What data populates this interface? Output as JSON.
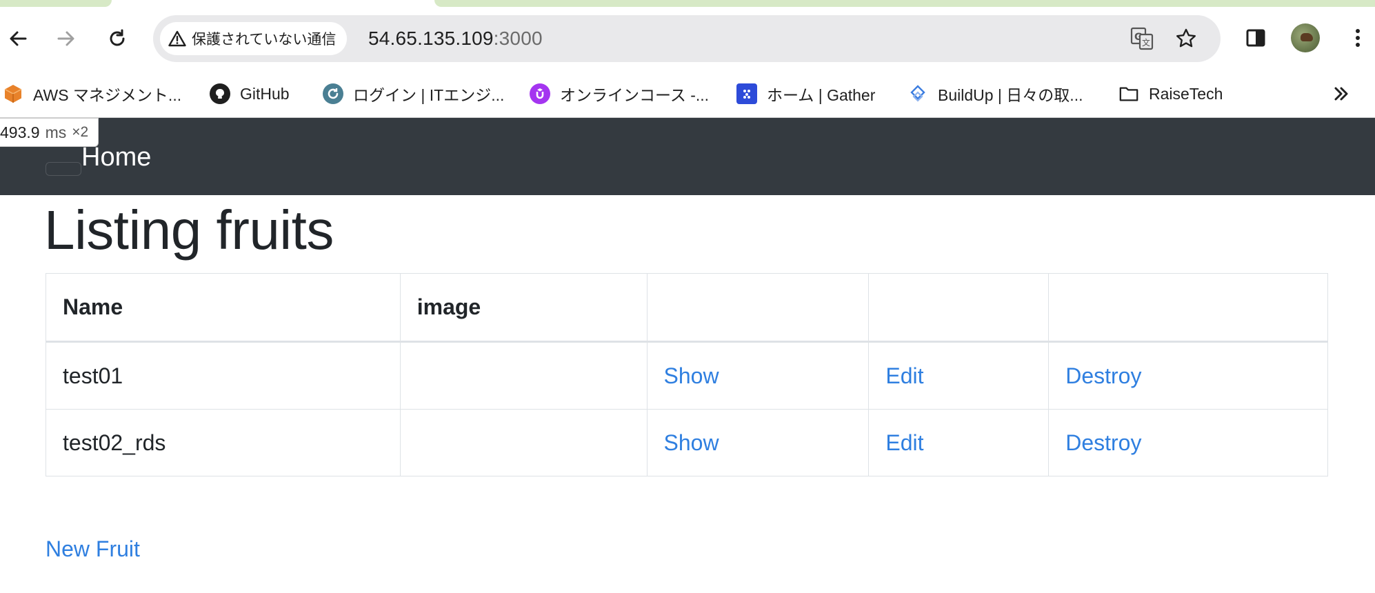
{
  "browser": {
    "security_label": "保護されていない通信",
    "url_host": "54.65.135.109",
    "url_port": ":3000"
  },
  "bookmarks": [
    {
      "label": "AWS マネジメント...",
      "icon": "aws-cube-icon"
    },
    {
      "label": "GitHub",
      "icon": "github-icon"
    },
    {
      "label": "ログイン | ITエンジ...",
      "icon": "refresh-circle-icon"
    },
    {
      "label": "オンラインコース -...",
      "icon": "udemy-icon"
    },
    {
      "label": "ホーム | Gather",
      "icon": "gather-icon"
    },
    {
      "label": "BuildUp | 日々の取...",
      "icon": "buildup-icon"
    },
    {
      "label": "RaiseTech",
      "icon": "folder-icon"
    }
  ],
  "perf": {
    "value": "493.9",
    "unit": "ms",
    "multiplier": "×2"
  },
  "navbar": {
    "home_label": "Home"
  },
  "page": {
    "title": "Listing fruits",
    "columns": [
      "Name",
      "image",
      "",
      "",
      ""
    ],
    "rows": [
      {
        "name": "test01",
        "image": "",
        "show": "Show",
        "edit": "Edit",
        "destroy": "Destroy"
      },
      {
        "name": "test02_rds",
        "image": "",
        "show": "Show",
        "edit": "Edit",
        "destroy": "Destroy"
      }
    ],
    "new_link": "New Fruit"
  },
  "colors": {
    "navbar_bg": "#343a40",
    "link": "#2f7fe0",
    "tab_strip": "#d7e9c6"
  }
}
